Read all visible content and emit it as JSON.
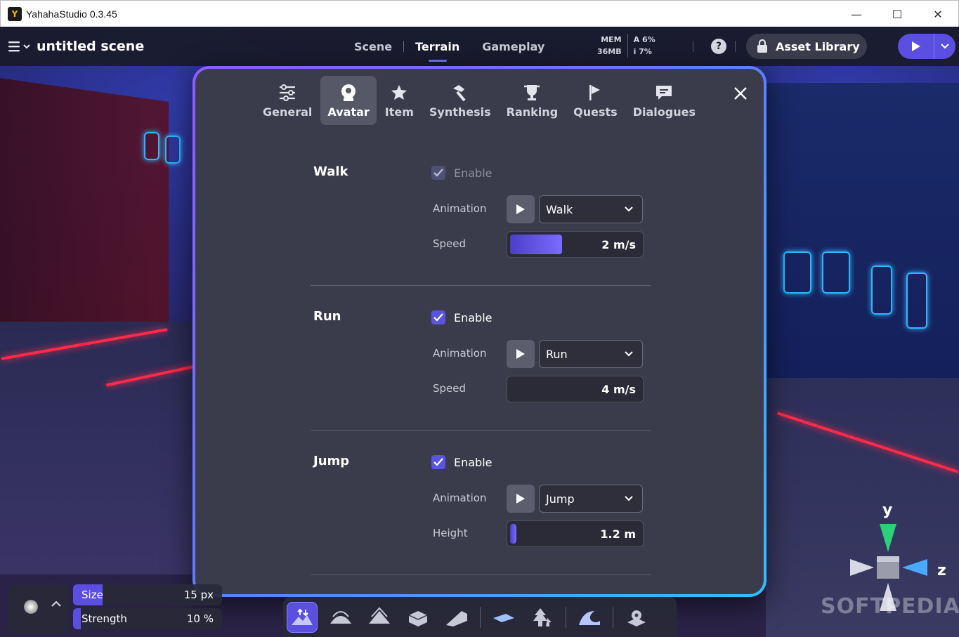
{
  "window": {
    "title": "YahahaStudio 0.3.45",
    "minimize": "—",
    "maximize": "☐",
    "close": "✕"
  },
  "toolbar": {
    "scene_title": "untitled scene",
    "tabs": [
      {
        "label": "Scene"
      },
      {
        "label": "Terrain"
      },
      {
        "label": "Gameplay"
      }
    ],
    "active_tab": "Terrain",
    "stats": {
      "mem_label": "MEM",
      "mem_value": "36MB",
      "a_label": "A",
      "a_value": "6%",
      "i_label": "i",
      "i_value": "7%"
    },
    "help_label": "?",
    "asset_library": "Asset Library"
  },
  "modal": {
    "tabs": [
      {
        "label": "General",
        "icon": "sliders-icon"
      },
      {
        "label": "Avatar",
        "icon": "avatar-icon"
      },
      {
        "label": "Item",
        "icon": "item-icon"
      },
      {
        "label": "Synthesis",
        "icon": "hammer-icon"
      },
      {
        "label": "Ranking",
        "icon": "trophy-icon"
      },
      {
        "label": "Quests",
        "icon": "flag-icon"
      },
      {
        "label": "Dialogues",
        "icon": "chat-icon"
      }
    ],
    "active_tab": "Avatar",
    "sections": [
      {
        "title": "Walk",
        "enable_label": "Enable",
        "enabled": true,
        "disabled": true,
        "animation_label": "Animation",
        "animation_value": "Walk",
        "param_label": "Speed",
        "param_value": "2 m/s",
        "param_fraction": 0.4
      },
      {
        "title": "Run",
        "enable_label": "Enable",
        "enabled": true,
        "disabled": false,
        "animation_label": "Animation",
        "animation_value": "Run",
        "param_label": "Speed",
        "param_value": "4 m/s",
        "param_fraction": 0.0
      },
      {
        "title": "Jump",
        "enable_label": "Enable",
        "enabled": true,
        "disabled": false,
        "animation_label": "Animation",
        "animation_value": "Jump",
        "param_label": "Height",
        "param_value": "1.2 m",
        "param_fraction": 0.05
      }
    ]
  },
  "brush": {
    "size_label": "Size",
    "size_value": "15 px",
    "size_fraction": 0.2,
    "strength_label": "Strength",
    "strength_value": "10 %",
    "strength_fraction": 0.05
  },
  "gizmo": {
    "y_label": "y",
    "z_label": "z"
  },
  "watermark": "SOFTPEDIA",
  "colors": {
    "accent": "#5a4fe0",
    "modal_border_start": "#8e5cff",
    "modal_border_end": "#2fc0ff"
  }
}
